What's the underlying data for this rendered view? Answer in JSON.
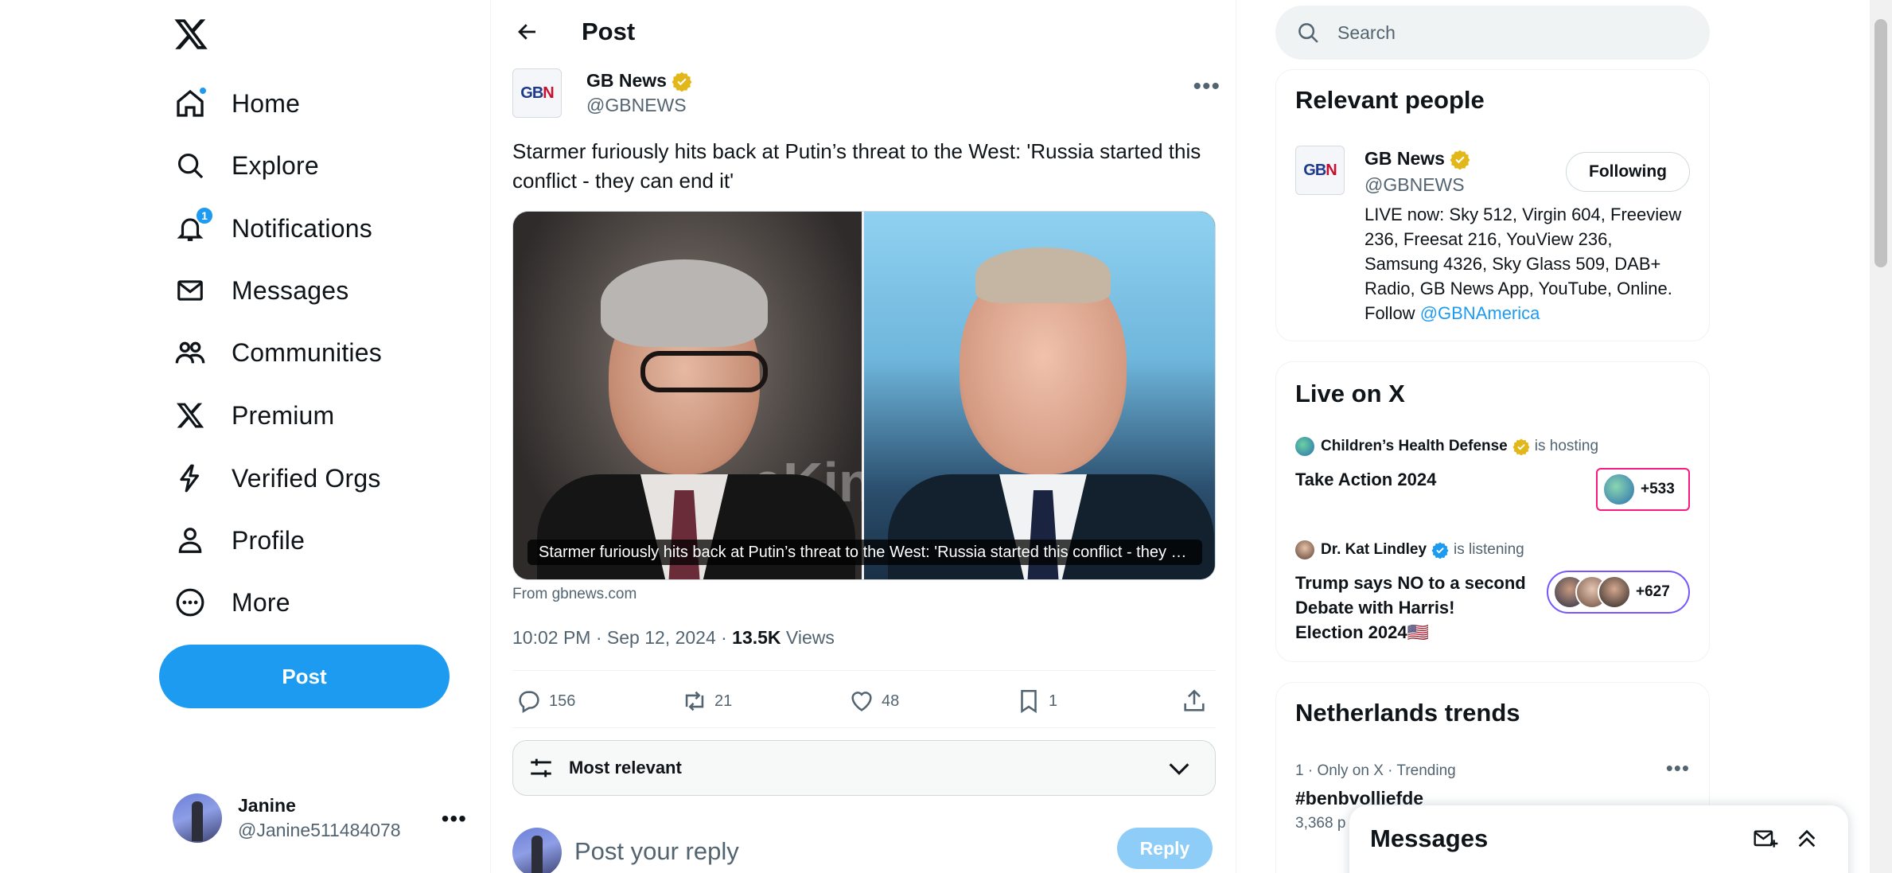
{
  "nav": {
    "items": [
      {
        "label": "Home",
        "icon": "home-icon"
      },
      {
        "label": "Explore",
        "icon": "search-icon"
      },
      {
        "label": "Notifications",
        "icon": "bell-icon",
        "badge": "1"
      },
      {
        "label": "Messages",
        "icon": "envelope-icon"
      },
      {
        "label": "Communities",
        "icon": "people-icon"
      },
      {
        "label": "Premium",
        "icon": "x-logo-icon"
      },
      {
        "label": "Verified Orgs",
        "icon": "lightning-icon"
      },
      {
        "label": "Profile",
        "icon": "person-icon"
      },
      {
        "label": "More",
        "icon": "more-circle-icon"
      }
    ],
    "post_button": "Post",
    "account": {
      "name": "Janine",
      "handle": "@Janine511484078"
    }
  },
  "main": {
    "header_title": "Post",
    "tweet": {
      "author_name": "GB News",
      "author_handle": "@GBNEWS",
      "logo_text": {
        "g": "GB",
        "n": "N"
      },
      "text": "Starmer furiously hits back at Putin’s threat to the West: 'Russia started this conflict - they can end it'",
      "media_caption": "Starmer furiously hits back at Putin’s threat to the West: 'Russia started this conflict - they can end it'",
      "media_bg_text": "eKin",
      "source": "From gbnews.com",
      "timestamp": "10:02 PM · Sep 12, 2024 · ",
      "views_count": "13.5K",
      "views_label": " Views",
      "replies": "156",
      "reposts": "21",
      "likes": "48",
      "bookmarks": "1"
    },
    "sort_label": "Most relevant",
    "reply_placeholder": "Post your reply",
    "reply_button": "Reply"
  },
  "sidebar": {
    "search_placeholder": "Search",
    "relevant_people": {
      "title": "Relevant people",
      "name": "GB News",
      "handle": "@GBNEWS",
      "follow_label": "Following",
      "bio": "LIVE now: Sky 512, Virgin 604, Freeview 236, Freesat 216, YouView 236, Samsung 4326, Sky Glass 509, DAB+ Radio, GB News App, YouTube, Online. Follow ",
      "bio_link": "@GBNAmerica"
    },
    "live": {
      "title": "Live on X",
      "spaces": [
        {
          "host": "Children’s Health Defense",
          "status": "is hosting",
          "title": "Take Action 2024",
          "count": "+533"
        },
        {
          "host": "Dr. Kat Lindley",
          "status": "is listening",
          "title": "Trump says NO to a second Debate with Harris! Election 2024🇺🇸",
          "count": "+627"
        }
      ]
    },
    "trends": {
      "title": "Netherlands trends",
      "meta": "1 · Only on X · Trending",
      "name": "#benbvolliefde",
      "count": "3,368 p"
    },
    "messages_title": "Messages"
  },
  "colors": {
    "accent": "#1d9bf0",
    "verified_gold": "#e2b719",
    "verified_blue": "#1d9bf0",
    "host_pill": "#f91880",
    "listen_pill": "#7856ff"
  }
}
